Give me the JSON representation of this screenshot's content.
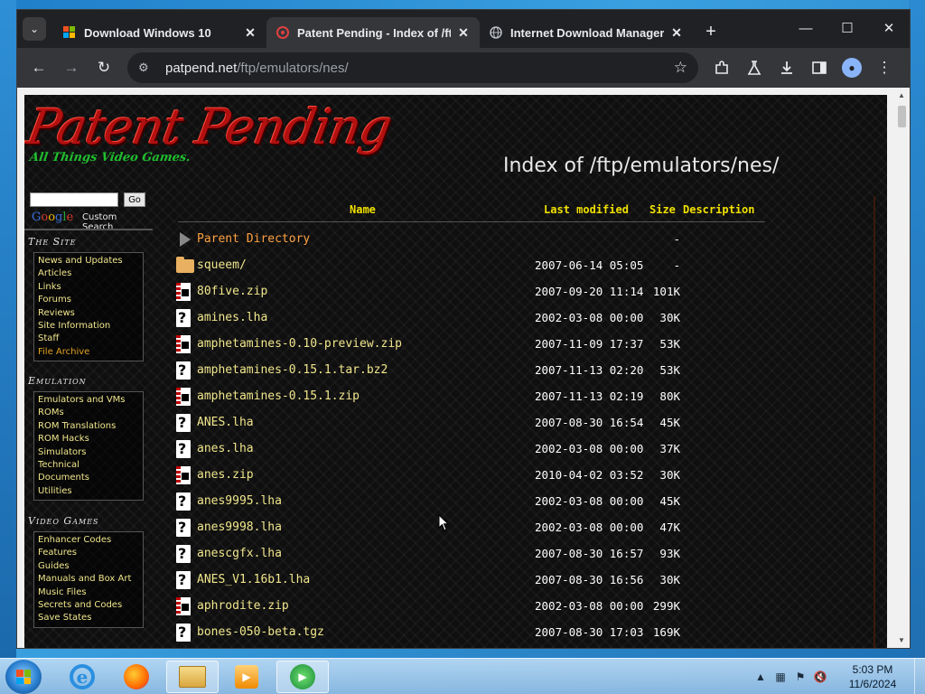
{
  "browser": {
    "tabs": [
      {
        "title": "Download Windows 10",
        "favicon": "windows-icon",
        "active": false
      },
      {
        "title": "Patent Pending - Index of /ftp/",
        "favicon": "patent-pending-favicon",
        "active": true
      },
      {
        "title": "Internet Download Manager is",
        "favicon": "globe-icon",
        "active": false
      }
    ],
    "new_tab": "+",
    "window_controls": {
      "minimize": "—",
      "maximize": "☐",
      "close": "✕"
    },
    "address": {
      "host": "patpend.net",
      "path": "/ftp/emulators/nes/"
    },
    "toolbar_icons": [
      "back-icon",
      "forward-icon",
      "reload-icon",
      "site-info-icon",
      "bookmark-star-icon",
      "extensions-icon",
      "labs-icon",
      "download-icon",
      "side-panel-icon",
      "profile-icon",
      "menu-icon"
    ]
  },
  "site": {
    "logo_main": "Patent Pending",
    "logo_tagline": "All Things Video Games.",
    "heading": "Index of /ftp/emulators/nes/",
    "search": {
      "placeholder": "",
      "go_label": "Go",
      "brand": "Google",
      "brand_suffix": "Custom Search"
    },
    "sections": [
      {
        "title": "The Site",
        "links": [
          "News and Updates",
          "Articles",
          "Links",
          "Forums",
          "Reviews",
          "Site Information",
          "Staff",
          "File Archive"
        ]
      },
      {
        "title": "Emulation",
        "links": [
          "Emulators and VMs",
          "ROMs",
          "ROM Translations",
          "ROM Hacks",
          "Simulators",
          "Technical",
          "Documents",
          "Utilities"
        ]
      },
      {
        "title": "Video Games",
        "links": [
          "Enhancer Codes",
          "Features",
          "Guides",
          "Manuals and Box Art",
          "Music Files",
          "Secrets and Codes",
          "Save States"
        ]
      }
    ],
    "current_link": "File Archive"
  },
  "listing": {
    "headers": {
      "name": "Name",
      "modified": "Last modified",
      "size": "Size",
      "description": "Description"
    },
    "rows": [
      {
        "name": "Parent Directory",
        "date": "",
        "size": "-",
        "type": "back"
      },
      {
        "name": "squeem/",
        "date": "2007-06-14 05:05",
        "size": "-",
        "type": "folder"
      },
      {
        "name": "80five.zip",
        "date": "2007-09-20 11:14",
        "size": "101K",
        "type": "zip"
      },
      {
        "name": "amines.lha",
        "date": "2002-03-08 00:00",
        "size": "30K",
        "type": "unknown"
      },
      {
        "name": "amphetamines-0.10-preview.zip",
        "date": "2007-11-09 17:37",
        "size": "53K",
        "type": "zip"
      },
      {
        "name": "amphetamines-0.15.1.tar.bz2",
        "date": "2007-11-13 02:20",
        "size": "53K",
        "type": "unknown"
      },
      {
        "name": "amphetamines-0.15.1.zip",
        "date": "2007-11-13 02:19",
        "size": "80K",
        "type": "zip"
      },
      {
        "name": "ANES.lha",
        "date": "2007-08-30 16:54",
        "size": "45K",
        "type": "unknown"
      },
      {
        "name": "anes.lha",
        "date": "2002-03-08 00:00",
        "size": "37K",
        "type": "unknown"
      },
      {
        "name": "anes.zip",
        "date": "2010-04-02 03:52",
        "size": "30K",
        "type": "zip"
      },
      {
        "name": "anes9995.lha",
        "date": "2002-03-08 00:00",
        "size": "45K",
        "type": "unknown"
      },
      {
        "name": "anes9998.lha",
        "date": "2002-03-08 00:00",
        "size": "47K",
        "type": "unknown"
      },
      {
        "name": "anescgfx.lha",
        "date": "2007-08-30 16:57",
        "size": "93K",
        "type": "unknown"
      },
      {
        "name": "ANES_V1.16b1.lha",
        "date": "2007-08-30 16:56",
        "size": "30K",
        "type": "unknown"
      },
      {
        "name": "aphrodite.zip",
        "date": "2002-03-08 00:00",
        "size": "299K",
        "type": "zip"
      },
      {
        "name": "bones-050-beta.tgz",
        "date": "2007-08-30 17:03",
        "size": "169K",
        "type": "unknown"
      }
    ]
  },
  "taskbar": {
    "items": [
      "start-button",
      "internet-explorer-icon",
      "firefox-icon",
      "file-explorer-icon",
      "media-player-icon",
      "download-manager-icon"
    ],
    "clock_time": "5:03 PM",
    "clock_date": "11/6/2024"
  }
}
